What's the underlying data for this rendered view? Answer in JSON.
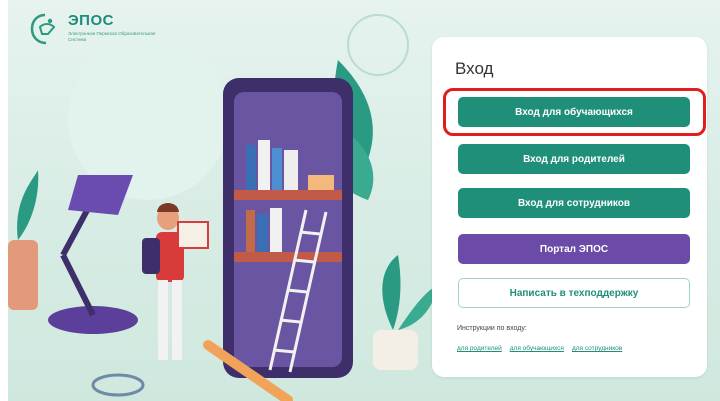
{
  "brand": {
    "name": "ЭПОС",
    "subtitle": "Электронная Пермская Образовательная Система"
  },
  "login": {
    "title": "Вход",
    "buttons": {
      "students": "Вход для обучающихся",
      "parents": "Вход для родителей",
      "staff": "Вход для сотрудников",
      "portal": "Портал ЭПОС",
      "support": "Написать в техподдержку"
    },
    "instructions": {
      "label": "Инструкции по входу:",
      "links": [
        "для родителей",
        "для обучающихся",
        "для сотрудников"
      ]
    }
  },
  "colors": {
    "primary": "#1f8f7a",
    "portal": "#6b4aa8",
    "highlight": "#e01e1e",
    "background": "#d7ece4"
  },
  "icons": {
    "logo": "epos-logo-icon"
  }
}
